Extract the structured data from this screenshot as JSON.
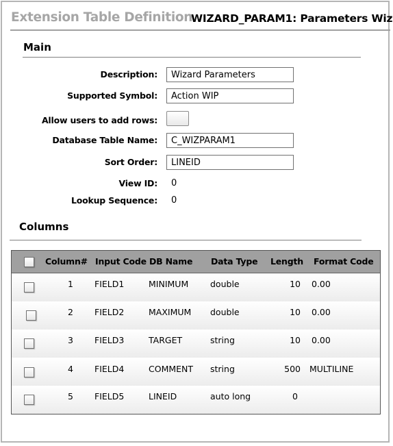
{
  "header": {
    "page_title": "Extension Table Definition",
    "record_title": "WIZARD_PARAM1: Parameters Wiz"
  },
  "main": {
    "section_title": "Main",
    "fields": {
      "description": {
        "label": "Description:",
        "value": "Wizard Parameters"
      },
      "supported_symbol": {
        "label": "Supported Symbol:",
        "value": "Action WIP"
      },
      "allow_add_rows": {
        "label": "Allow users to add rows:",
        "checked": false
      },
      "db_table_name": {
        "label": "Database Table Name:",
        "value": "C_WIZPARAM1"
      },
      "sort_order": {
        "label": "Sort Order:",
        "value": "LINEID"
      },
      "view_id": {
        "label": "View ID:",
        "value": "0"
      },
      "lookup_sequence": {
        "label": "Lookup Sequence:",
        "value": "0"
      }
    }
  },
  "columns": {
    "section_title": "Columns",
    "headers": [
      "Column#",
      "Input Code",
      "DB Name",
      "Data Type",
      "Length",
      "Format Code"
    ],
    "rows": [
      {
        "num": "1",
        "input_code": "FIELD1",
        "db_name": "MINIMUM",
        "data_type": "double",
        "length": "10",
        "format_code": "0.00"
      },
      {
        "num": "2",
        "input_code": "FIELD2",
        "db_name": "MAXIMUM",
        "data_type": "double",
        "length": "10",
        "format_code": "0.00"
      },
      {
        "num": "3",
        "input_code": "FIELD3",
        "db_name": "TARGET",
        "data_type": "string",
        "length": "10",
        "format_code": "0.00"
      },
      {
        "num": "4",
        "input_code": "FIELD4",
        "db_name": "COMMENT",
        "data_type": "string",
        "length": "500",
        "format_code": "MULTILINE"
      },
      {
        "num": "5",
        "input_code": "FIELD5",
        "db_name": "LINEID",
        "data_type": "auto long",
        "length": "0",
        "format_code": ""
      }
    ]
  }
}
